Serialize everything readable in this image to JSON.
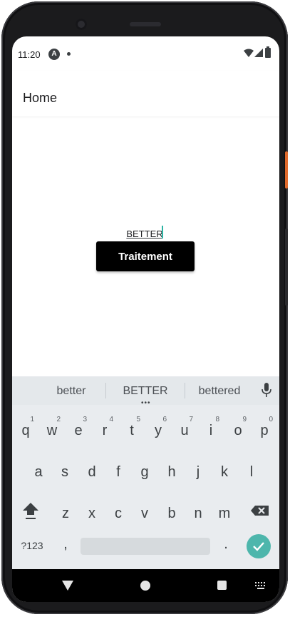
{
  "status_bar": {
    "time": "11:20"
  },
  "app_bar": {
    "title": "Home"
  },
  "main": {
    "text_input_value": "BETTER",
    "button_label": "Traitement"
  },
  "keyboard": {
    "suggestions": [
      "better",
      "BETTER",
      "bettered"
    ],
    "row1": [
      {
        "key": "q",
        "hint": "1"
      },
      {
        "key": "w",
        "hint": "2"
      },
      {
        "key": "e",
        "hint": "3"
      },
      {
        "key": "r",
        "hint": "4"
      },
      {
        "key": "t",
        "hint": "5"
      },
      {
        "key": "y",
        "hint": "6"
      },
      {
        "key": "u",
        "hint": "7"
      },
      {
        "key": "i",
        "hint": "8"
      },
      {
        "key": "o",
        "hint": "9"
      },
      {
        "key": "p",
        "hint": "0"
      }
    ],
    "row2": [
      "a",
      "s",
      "d",
      "f",
      "g",
      "h",
      "j",
      "k",
      "l"
    ],
    "row3": [
      "z",
      "x",
      "c",
      "v",
      "b",
      "n",
      "m"
    ],
    "symbols_label": "?123",
    "comma": ",",
    "period": "."
  },
  "colors": {
    "button_bg": "#000000",
    "enter_key": "#4db6ac",
    "caret": "#2bb3a3",
    "keyboard_bg": "#e9ecef"
  }
}
